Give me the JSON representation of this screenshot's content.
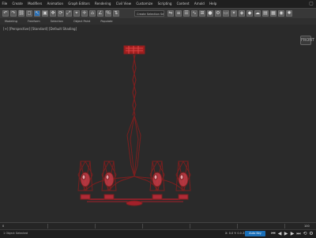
{
  "menubar": {
    "items": [
      "File",
      "Create",
      "Modifiers",
      "Animation",
      "Graph Editors",
      "Rendering",
      "Civil View",
      "Customize",
      "Scripting",
      "Content",
      "Arnold",
      "Help"
    ],
    "topright": "▢"
  },
  "toolbar": {
    "selection_set": "Create Selection Set",
    "icons": [
      "undo-icon",
      "redo-icon",
      "select-icon",
      "move-icon",
      "rotate-icon",
      "scale-icon"
    ]
  },
  "ribbon": {
    "tabs": [
      "Modeling",
      "Freeform",
      "Selection",
      "Object Paint",
      "Populate"
    ]
  },
  "viewport": {
    "label": "[+] [Perspective] [Standard] [Default Shading]",
    "viewcube": "FRONT",
    "colors": {
      "wire": "#8d1f1f",
      "glass": "#c63a45",
      "glass_light": "#e6a0a8"
    }
  },
  "statusbar": {
    "left_text": "1 Object Selected",
    "coords": "X: 0.0  Y: 0.0  Z: 0.0",
    "autokey": "Auto Key",
    "set_key": "Set Key",
    "timeline_start": "0",
    "timeline_end": "100"
  }
}
